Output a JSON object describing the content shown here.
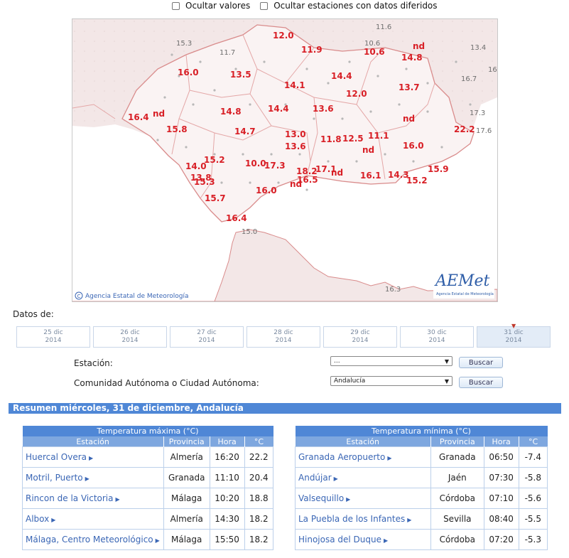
{
  "options": {
    "hide_values": "Ocultar valores",
    "hide_deferred": "Ocultar estaciones con datos diferidos"
  },
  "map": {
    "credit": "Agencia Estatal de Meteorología",
    "logo_text": "AEMet",
    "logo_sub": "Agencia Estatal de Meteorología",
    "values_red": [
      {
        "t": "12.0"
      },
      {
        "t": "11.9"
      },
      {
        "t": "10.6"
      },
      {
        "t": "14.8"
      },
      {
        "t": "nd"
      },
      {
        "t": "16.0"
      },
      {
        "t": "13.5"
      },
      {
        "t": "14.4"
      },
      {
        "t": "14.1"
      },
      {
        "t": "12.0"
      },
      {
        "t": "13.7"
      },
      {
        "t": "16.4"
      },
      {
        "t": "nd"
      },
      {
        "t": "14.8"
      },
      {
        "t": "14.4"
      },
      {
        "t": "13.6"
      },
      {
        "t": "nd"
      },
      {
        "t": "15.8"
      },
      {
        "t": "14.7"
      },
      {
        "t": "13.0"
      },
      {
        "t": "11.8"
      },
      {
        "t": "12.5"
      },
      {
        "t": "11.1"
      },
      {
        "t": "22.2"
      },
      {
        "t": "13.6"
      },
      {
        "t": "nd"
      },
      {
        "t": "16.0"
      },
      {
        "t": "15.2"
      },
      {
        "t": "14.0"
      },
      {
        "t": "10.0"
      },
      {
        "t": "17.3"
      },
      {
        "t": "18.2"
      },
      {
        "t": "17.1"
      },
      {
        "t": "nd"
      },
      {
        "t": "16.1"
      },
      {
        "t": "14.3"
      },
      {
        "t": "15.9"
      },
      {
        "t": "13.8"
      },
      {
        "t": "15.3"
      },
      {
        "t": "16.0"
      },
      {
        "t": "nd"
      },
      {
        "t": "16.5"
      },
      {
        "t": "15.2"
      },
      {
        "t": "15.7"
      },
      {
        "t": "16.4"
      }
    ],
    "values_grey": [
      {
        "t": "15.3"
      },
      {
        "t": "11.7"
      },
      {
        "t": "11.6"
      },
      {
        "t": "10.6"
      },
      {
        "t": "13.4"
      },
      {
        "t": "16.9"
      },
      {
        "t": "16.7"
      },
      {
        "t": "17.3"
      },
      {
        "t": "17.6"
      },
      {
        "t": "15.0"
      },
      {
        "t": "16.3"
      }
    ]
  },
  "datos_label": "Datos de:",
  "dates": [
    {
      "day": "25 dic",
      "year": "2014"
    },
    {
      "day": "26 dic",
      "year": "2014"
    },
    {
      "day": "27 dic",
      "year": "2014"
    },
    {
      "day": "28 dic",
      "year": "2014"
    },
    {
      "day": "29 dic",
      "year": "2014"
    },
    {
      "day": "30 dic",
      "year": "2014"
    },
    {
      "day": "31 dic",
      "year": "2014"
    }
  ],
  "form": {
    "station_label": "Estación:",
    "station_value": "...",
    "region_label": "Comunidad Autónoma o Ciudad Autónoma:",
    "region_value": "Andalucía",
    "search_label": "Buscar"
  },
  "summary_title": "Resumen miércoles, 31 de diciembre, Andalucía",
  "tmax": {
    "caption": "Temperatura máxima (°C)",
    "headers": [
      "Estación",
      "Provincia",
      "Hora",
      "°C"
    ],
    "rows": [
      {
        "station": "Huercal Overa",
        "prov": "Almería",
        "hour": "16:20",
        "val": "22.2"
      },
      {
        "station": "Motril, Puerto",
        "prov": "Granada",
        "hour": "11:10",
        "val": "20.4"
      },
      {
        "station": "Rincon de la Victoria",
        "prov": "Málaga",
        "hour": "10:20",
        "val": "18.8"
      },
      {
        "station": "Albox",
        "prov": "Almería",
        "hour": "14:30",
        "val": "18.2"
      },
      {
        "station": "Málaga, Centro Meteorológico",
        "prov": "Málaga",
        "hour": "15:50",
        "val": "18.2"
      }
    ]
  },
  "tmin": {
    "caption": "Temperatura mínima (°C)",
    "headers": [
      "Estación",
      "Provincia",
      "Hora",
      "°C"
    ],
    "rows": [
      {
        "station": "Granada Aeropuerto",
        "prov": "Granada",
        "hour": "06:50",
        "val": "-7.4"
      },
      {
        "station": "Andújar",
        "prov": "Jaén",
        "hour": "07:30",
        "val": "-5.8"
      },
      {
        "station": "Valsequillo",
        "prov": "Córdoba",
        "hour": "07:10",
        "val": "-5.6"
      },
      {
        "station": "La Puebla de los Infantes",
        "prov": "Sevilla",
        "hour": "08:40",
        "val": "-5.5"
      },
      {
        "station": "Hinojosa del Duque",
        "prov": "Córdoba",
        "hour": "07:20",
        "val": "-5.3"
      }
    ]
  },
  "colors": {
    "accent": "#4f87d6",
    "header": "#7ea7df",
    "value_red": "#d81f26",
    "link": "#3a66b5"
  }
}
